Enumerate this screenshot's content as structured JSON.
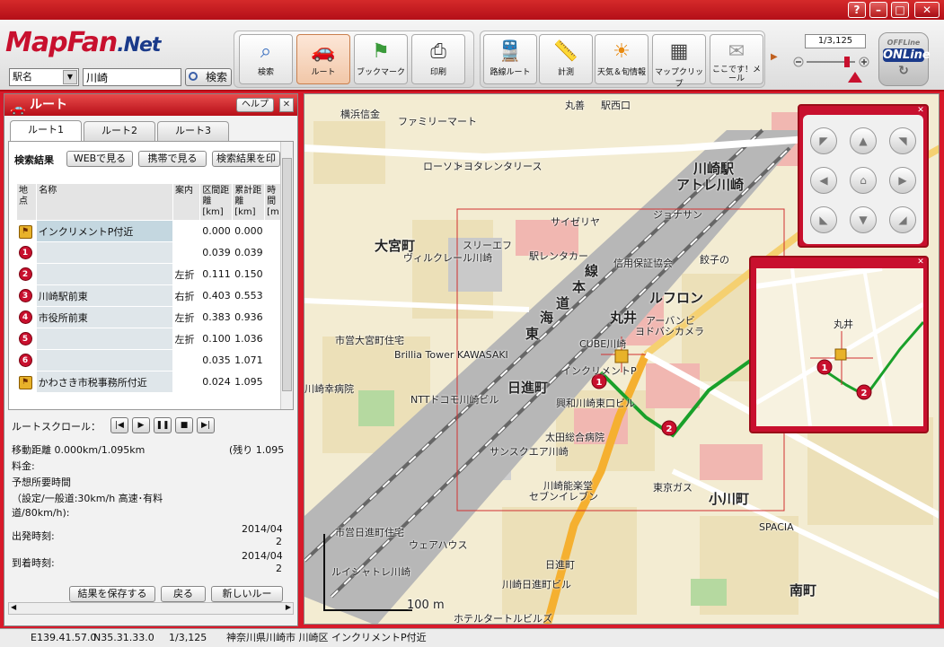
{
  "window": {
    "btn_help": "?",
    "btn_min": "–",
    "btn_max": "□",
    "btn_close": "✕"
  },
  "logo": {
    "main": "MapFan",
    "suffix": ".Net"
  },
  "search": {
    "type_value": "駅名",
    "query_value": "川崎",
    "button_label": "検索"
  },
  "toolbar": {
    "buttons": [
      {
        "label": "検索",
        "icon": "magnifier-icon"
      },
      {
        "label": "ルート",
        "icon": "car-icon"
      },
      {
        "label": "ブックマーク",
        "icon": "bookmark-icon"
      },
      {
        "label": "印刷",
        "icon": "printer-icon"
      },
      {
        "label": "路線ルート",
        "icon": "train-icon"
      },
      {
        "label": "計測",
        "icon": "ruler-icon"
      },
      {
        "label": "天気＆旬情報",
        "icon": "sun-icon"
      },
      {
        "label": "マップクリップ",
        "icon": "clip-icon"
      },
      {
        "label": "ここです！メール",
        "icon": "mail-icon"
      }
    ],
    "scale_value": "1/3,125",
    "online_top": "OFFLine",
    "online_label": "ONLine"
  },
  "panel": {
    "title": "ルート",
    "help_label": "ヘルプ",
    "tabs": [
      "ルート1",
      "ルート2",
      "ルート3"
    ],
    "result_label": "検索結果",
    "web_button": "WEBで見る",
    "mobile_button": "携帯で見る",
    "result_button": "検索結果を印",
    "columns": {
      "point": "地点",
      "name": "名称",
      "guide": "案内",
      "segment": "区間距離[km]",
      "cumulative": "累計距離[km]",
      "time": "時間[m"
    },
    "rows": [
      {
        "marker": "goal",
        "label": "",
        "name": "インクリメントP付近",
        "guide": "",
        "segment": "0.000",
        "cumulative": "0.000"
      },
      {
        "marker": "num",
        "label": "1",
        "name": "",
        "guide": "",
        "segment": "0.039",
        "cumulative": "0.039"
      },
      {
        "marker": "num",
        "label": "2",
        "name": "",
        "guide": "左折",
        "segment": "0.111",
        "cumulative": "0.150"
      },
      {
        "marker": "num",
        "label": "3",
        "name": "川崎駅前東",
        "guide": "右折",
        "segment": "0.403",
        "cumulative": "0.553"
      },
      {
        "marker": "num",
        "label": "4",
        "name": "市役所前東",
        "guide": "左折",
        "segment": "0.383",
        "cumulative": "0.936"
      },
      {
        "marker": "num",
        "label": "5",
        "name": "",
        "guide": "左折",
        "segment": "0.100",
        "cumulative": "1.036"
      },
      {
        "marker": "num",
        "label": "6",
        "name": "",
        "guide": "",
        "segment": "0.035",
        "cumulative": "1.071"
      },
      {
        "marker": "goal",
        "label": "",
        "name": "かわさき市税事務所付近",
        "guide": "",
        "segment": "0.024",
        "cumulative": "1.095"
      }
    ],
    "scroll_label": "ルートスクロール：",
    "distance": "移動距離 0.000km/1.095km",
    "remaining": "(残り 1.095",
    "fare": "料金:",
    "time_estimate": "予想所要時間",
    "speed_note_1": "（設定/一般道:30km/h 高速･有料",
    "speed_note_2": "道/80km/h):",
    "departure_label": "出発時刻:",
    "departure_value_1": "2014/04",
    "departure_value_2": "2",
    "arrival_label": "到着時刻:",
    "arrival_value_1": "2014/04",
    "arrival_value_2": "2",
    "save_button": "結果を保存する",
    "back_button": "戻る",
    "new_button": "新しいルー"
  },
  "map": {
    "labels": [
      "川崎駅",
      "アトレ川崎",
      "大宮町",
      "日進町",
      "丸井",
      "ルフロン",
      "小川町",
      "南町",
      "本",
      "道",
      "海",
      "東",
      "線",
      "横浜信金",
      "ファミリーマート",
      "ヨドバシカメラ",
      "CUBE川崎",
      "インクリメントP",
      "興和川崎東口ビル",
      "太田総合病院",
      "サンスクエア川崎",
      "川崎能楽堂",
      "セブンイレブン",
      "東京ガス",
      "アーバンビ",
      "Brillia Tower KAWASAKI",
      "NTTドコモ川崎ビル",
      "市営大宮町住宅",
      "川崎幸病院",
      "ウェアハウス",
      "日進町",
      "丸善",
      "駅西口",
      "サイゼリヤ",
      "ジョナサン",
      "信用保証協会",
      "駅レンタカー",
      "ローソン",
      "トヨタレンタリース",
      "ホテルタートルビルズ",
      "市営日進町住宅",
      "川崎日進町ビル",
      "SPACIA",
      "ルイシャトレ川崎",
      "スリーエフ",
      "ヴィルクレール川崎",
      "餃子の"
    ],
    "scale_text": "100 m"
  },
  "overview": {
    "label": "丸井"
  },
  "status": {
    "lon": "E139.41.57.0",
    "lat": "N35.31.33.0",
    "scale": "1/3,125",
    "address": "神奈川県川崎市 川崎区 インクリメントP付近"
  }
}
